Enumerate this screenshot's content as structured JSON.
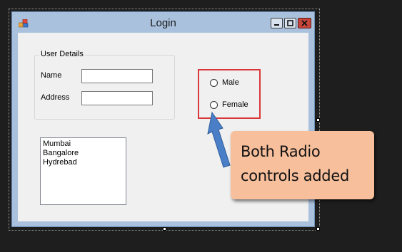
{
  "window": {
    "title": "Login",
    "controls": {
      "minimize": "minimize-icon",
      "maximize": "maximize-icon",
      "close": "close-icon"
    }
  },
  "user_details": {
    "group_title": "User Details",
    "name_label": "Name",
    "name_value": "",
    "address_label": "Address",
    "address_value": ""
  },
  "cities_listbox": {
    "items": [
      "Mumbai",
      "Bangalore",
      "Hydrebad"
    ]
  },
  "gender_radios": {
    "male_label": "Male",
    "female_label": "Female"
  },
  "annotation": {
    "text": "Both Radio\ncontrols added",
    "highlight_color": "#d9383a",
    "callout_color": "#f7bf9c",
    "arrow_color": "#4a7fc8"
  }
}
